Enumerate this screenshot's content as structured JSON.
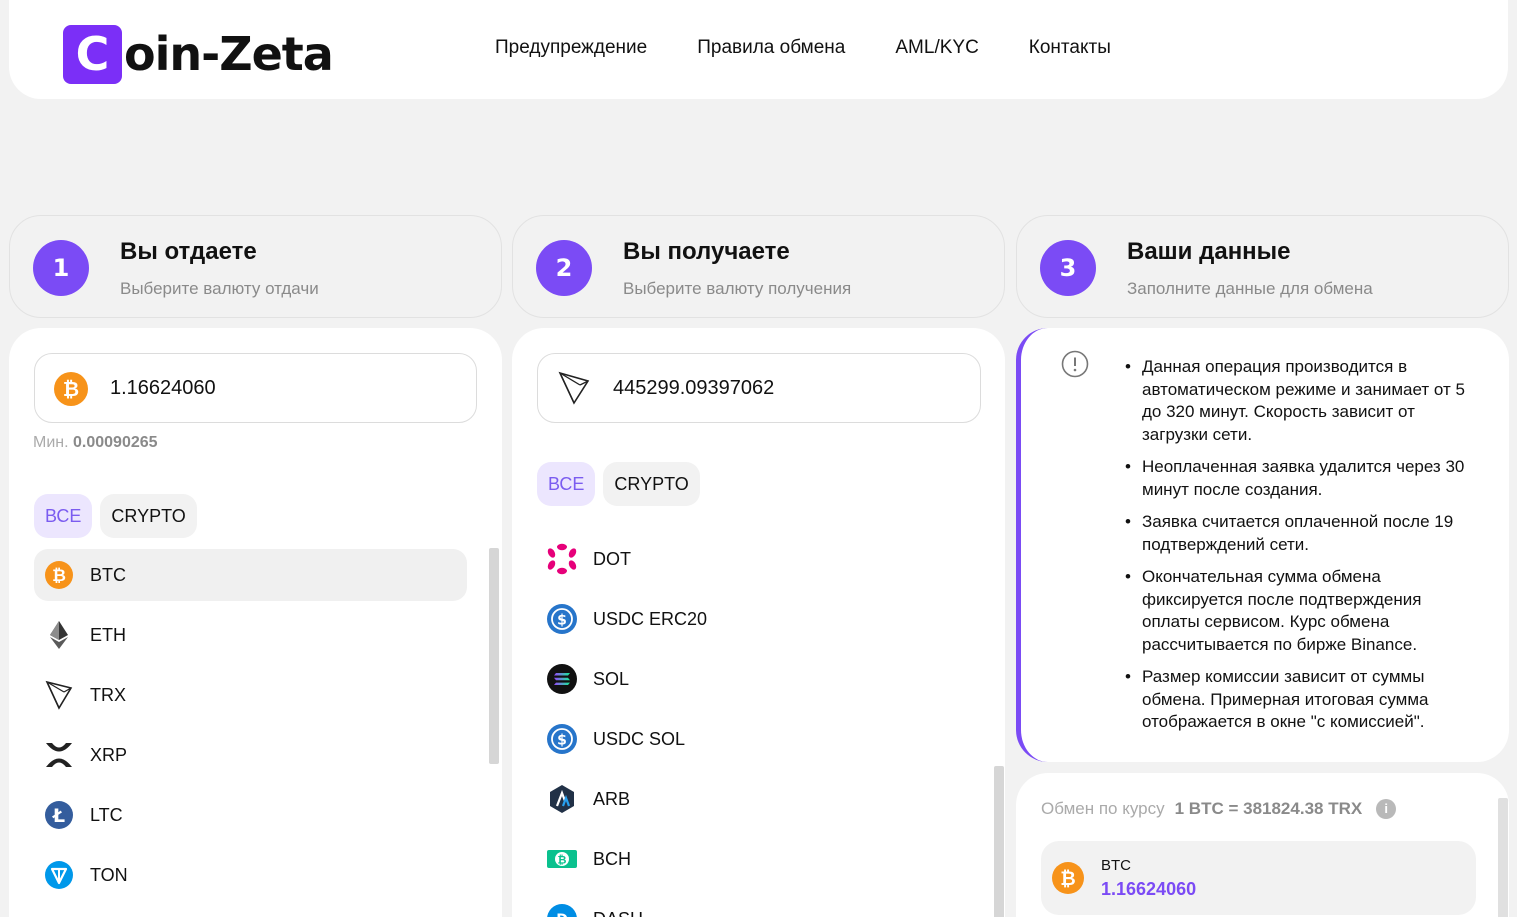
{
  "header": {
    "logo_letter": "C",
    "logo_text": "oin-Zeta",
    "nav": [
      "Предупреждение",
      "Правила обмена",
      "AML/KYC",
      "Контакты"
    ]
  },
  "steps": [
    {
      "num": "1",
      "title": "Вы отдаете",
      "subtitle": "Выберите валюту отдачи"
    },
    {
      "num": "2",
      "title": "Вы получаете",
      "subtitle": "Выберите валюту получения"
    },
    {
      "num": "3",
      "title": "Ваши данные",
      "subtitle": "Заполните данные для обмена"
    }
  ],
  "give": {
    "amount": "1.16624060",
    "min_label": "Мин.",
    "min_value": "0.00090265",
    "filters": [
      "ВСЕ",
      "CRYPTO"
    ],
    "currencies": [
      "BTC",
      "ETH",
      "TRX",
      "XRP",
      "LTC",
      "TON"
    ],
    "selected": "BTC"
  },
  "receive": {
    "amount": "445299.09397062",
    "filters": [
      "ВСЕ",
      "CRYPTO"
    ],
    "currencies": [
      "DOT",
      "USDC ERC20",
      "SOL",
      "USDC SOL",
      "ARB",
      "BCH",
      "DASH"
    ]
  },
  "info": {
    "notes": [
      "Данная операция производится в автоматическом режиме и занимает от 5 до 320 минут. Скорость зависит от загрузки сети.",
      "Неоплаченная заявка удалится через 30 минут после создания.",
      "Заявка считается оплаченной после 19 подтверждений сети.",
      "Окончательная сумма обмена фиксируется после подтверждения оплаты сервисом. Курс обмена рассчитывается по бирже Binance.",
      "Размер комиссии зависит от суммы обмена. Примерная итоговая сумма отображается в окне \"с комиссией\"."
    ]
  },
  "rate": {
    "label": "Обмен по курсу",
    "value": "1 BTC = 381824.38 TRX",
    "info_glyph": "i"
  },
  "summary": {
    "code": "BTC",
    "amount": "1.16624060"
  },
  "colors": {
    "accent": "#7b4bf5",
    "logo": "#7b2ff7",
    "btc": "#f7931a"
  }
}
